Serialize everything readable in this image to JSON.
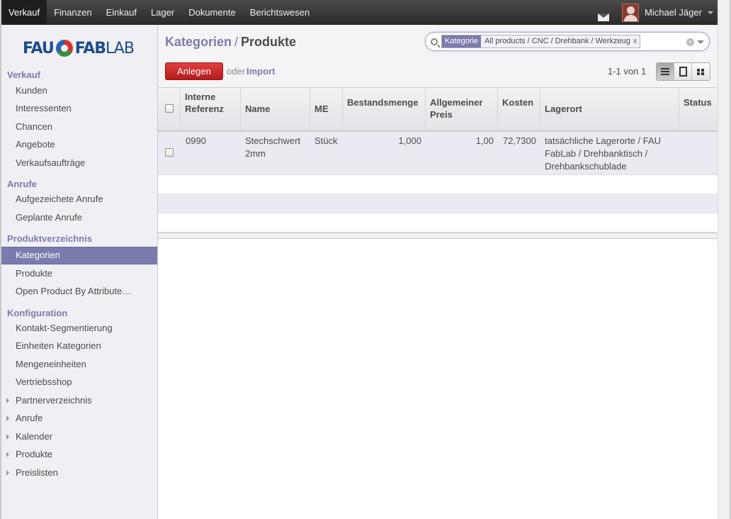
{
  "topbar": {
    "menu": [
      "Verkauf",
      "Finanzen",
      "Einkauf",
      "Lager",
      "Dokumente",
      "Berichtswesen"
    ],
    "active_index": 0,
    "user_name": "Michael Jäger"
  },
  "logo": {
    "part1": "FAU",
    "part2": "FAB",
    "part3": "LAB"
  },
  "sidebar": {
    "sections": [
      {
        "title": "Verkauf",
        "items": [
          "Kunden",
          "Interessenten",
          "Chancen",
          "Angebote",
          "Verkaufsaufträge"
        ]
      },
      {
        "title": "Anrufe",
        "items": [
          "Aufgezeichete Anrufe",
          "Geplante Anrufe"
        ]
      },
      {
        "title": "Produktverzeichnis",
        "items": [
          "Kategorien",
          "Produkte",
          "Open Product By Attribute…"
        ]
      },
      {
        "title": "Konfiguration",
        "items": [
          "Kontakt-Segmentierung",
          "Einheiten Kategorien",
          "Mengeneinheiten",
          "Vertriebsshop",
          "Partnerverzeichnis",
          "Anrufe",
          "Kalender",
          "Produkte",
          "Preislisten"
        ]
      }
    ],
    "active_item": "Kategorien",
    "expandable_items": [
      "Partnerverzeichnis",
      "Anrufe",
      "Kalender",
      "Produkte",
      "Preislisten"
    ]
  },
  "breadcrumb": {
    "parent": "Kategorien",
    "separator": "/",
    "current": "Produkte"
  },
  "search": {
    "facet_category": "Kategorie",
    "facet_value": "All products / CNC / Drehbank / Werkzeug",
    "facet_remove": "x"
  },
  "toolbar": {
    "create_label": "Anlegen",
    "or_text": "oder",
    "import_label": "Import",
    "pager": "1-1 von 1"
  },
  "table": {
    "headers": {
      "ref_line1": "Interne",
      "ref_line2": "Referenz",
      "name": "Name",
      "uom": "ME",
      "qty": "Bestandsmenge",
      "price_line1": "Allgemeiner",
      "price_line2": "Preis",
      "cost": "Kosten",
      "location": "Lagerort",
      "status": "Status"
    },
    "rows": [
      {
        "ref": "0990",
        "name_line1": "Stechschwert",
        "name_line2": "2mm",
        "uom": "Stück",
        "qty": "1,000",
        "price": "1,00",
        "cost": "72,7300",
        "location_line1": "tatsächliche Lagerorte / FAU",
        "location_line2": "FabLab / Drehbanktisch /",
        "location_line3": "Drehbankschublade",
        "status": ""
      }
    ]
  },
  "colors": {
    "accent": "#7c7bad",
    "create_button": "#c92a2a",
    "topbar": "#333333",
    "sidebar_bg": "#efeff4",
    "selected_row": "#eaeaf3"
  },
  "icons": [
    "mail-icon",
    "avatar",
    "search-icon",
    "list-view-icon",
    "form-view-icon",
    "kanban-view-icon",
    "checkbox"
  ]
}
